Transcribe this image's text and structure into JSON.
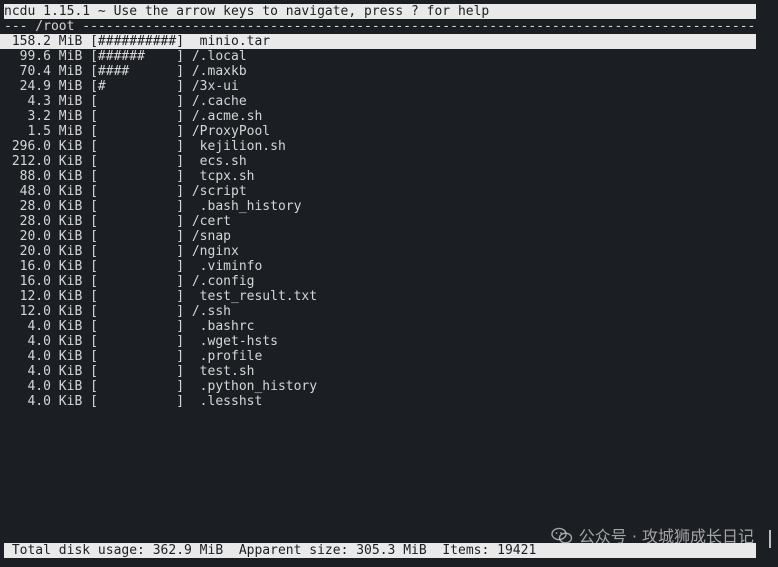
{
  "header": {
    "title": "ncdu 1.15.1 ~ Use the arrow keys to navigate, press ? for help",
    "path_line": "--- /root -----------------------------------------------------------------------------------------------------"
  },
  "entries": [
    {
      "size": "158.2 MiB",
      "bar": "[##########]",
      "name": " minio.tar",
      "selected": true
    },
    {
      "size": " 99.6 MiB",
      "bar": "[######    ]",
      "name": "/.local"
    },
    {
      "size": " 70.4 MiB",
      "bar": "[####      ]",
      "name": "/.maxkb"
    },
    {
      "size": " 24.9 MiB",
      "bar": "[#         ]",
      "name": "/3x-ui"
    },
    {
      "size": "  4.3 MiB",
      "bar": "[          ]",
      "name": "/.cache"
    },
    {
      "size": "  3.2 MiB",
      "bar": "[          ]",
      "name": "/.acme.sh"
    },
    {
      "size": "  1.5 MiB",
      "bar": "[          ]",
      "name": "/ProxyPool"
    },
    {
      "size": "296.0 KiB",
      "bar": "[          ]",
      "name": " kejilion.sh"
    },
    {
      "size": "212.0 KiB",
      "bar": "[          ]",
      "name": " ecs.sh"
    },
    {
      "size": " 88.0 KiB",
      "bar": "[          ]",
      "name": " tcpx.sh"
    },
    {
      "size": " 48.0 KiB",
      "bar": "[          ]",
      "name": "/script"
    },
    {
      "size": " 28.0 KiB",
      "bar": "[          ]",
      "name": " .bash_history"
    },
    {
      "size": " 28.0 KiB",
      "bar": "[          ]",
      "name": "/cert"
    },
    {
      "size": " 20.0 KiB",
      "bar": "[          ]",
      "name": "/snap"
    },
    {
      "size": " 20.0 KiB",
      "bar": "[          ]",
      "name": "/nginx"
    },
    {
      "size": " 16.0 KiB",
      "bar": "[          ]",
      "name": " .viminfo"
    },
    {
      "size": " 16.0 KiB",
      "bar": "[          ]",
      "name": "/.config"
    },
    {
      "size": " 12.0 KiB",
      "bar": "[          ]",
      "name": " test_result.txt"
    },
    {
      "size": " 12.0 KiB",
      "bar": "[          ]",
      "name": "/.ssh"
    },
    {
      "size": "  4.0 KiB",
      "bar": "[          ]",
      "name": " .bashrc"
    },
    {
      "size": "  4.0 KiB",
      "bar": "[          ]",
      "name": " .wget-hsts"
    },
    {
      "size": "  4.0 KiB",
      "bar": "[          ]",
      "name": " .profile"
    },
    {
      "size": "  4.0 KiB",
      "bar": "[          ]",
      "name": " test.sh"
    },
    {
      "size": "  4.0 KiB",
      "bar": "[          ]",
      "name": " .python_history"
    },
    {
      "size": "  4.0 KiB",
      "bar": "[          ]",
      "name": " .lesshst"
    }
  ],
  "status": {
    "total_label": " Total disk usage:",
    "total_value": "362.9 MiB",
    "apparent_label": "Apparent size:",
    "apparent_value": "305.3 MiB",
    "items_label": "Items:",
    "items_value": "19421"
  },
  "watermark": {
    "text": "公众号 · 攻城狮成长日记",
    "icon": "wechat-icon"
  },
  "colors": {
    "background": "#1b1e23",
    "foreground": "#d6d6d6",
    "inverse_bg": "#e9e9e9"
  }
}
